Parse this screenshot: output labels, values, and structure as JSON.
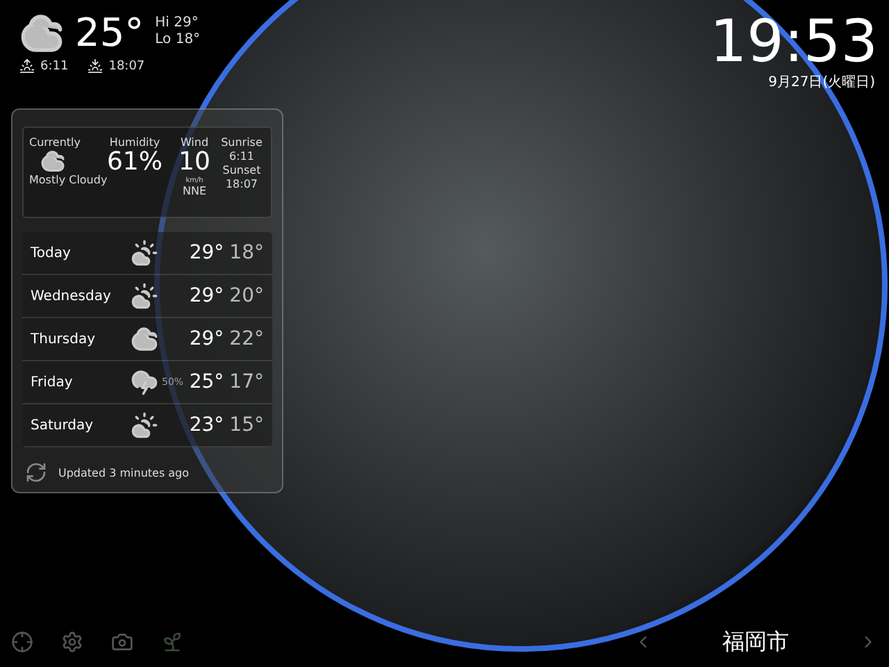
{
  "header": {
    "temperature": "25°",
    "high": "Hi 29°",
    "low": "Lo 18°",
    "sunrise": "6:11",
    "sunset": "18:07"
  },
  "current": {
    "label": "Currently",
    "condition": "Mostly Cloudy",
    "humidity_label": "Humidity",
    "humidity": "61%",
    "wind_label": "Wind",
    "wind_speed": "10",
    "wind_unit": "km/h",
    "wind_direction": "NNE",
    "sunrise_label": "Sunrise",
    "sunrise": "6:11",
    "sunset_label": "Sunset",
    "sunset": "18:07"
  },
  "forecast": [
    {
      "day": "Today",
      "kind": "partly-cloudy",
      "high": "29°",
      "low": "18°"
    },
    {
      "day": "Wednesday",
      "kind": "partly-cloudy",
      "high": "29°",
      "low": "20°"
    },
    {
      "day": "Thursday",
      "kind": "cloudy",
      "high": "29°",
      "low": "22°"
    },
    {
      "day": "Friday",
      "kind": "storm",
      "precip": "50%",
      "high": "25°",
      "low": "17°"
    },
    {
      "day": "Saturday",
      "kind": "partly-cloudy",
      "high": "23°",
      "low": "15°"
    }
  ],
  "updated": "Updated 3 minutes ago",
  "clock": {
    "time": "19:53",
    "date": "9月27日(火曜日)"
  },
  "location": {
    "city": "福岡市"
  }
}
